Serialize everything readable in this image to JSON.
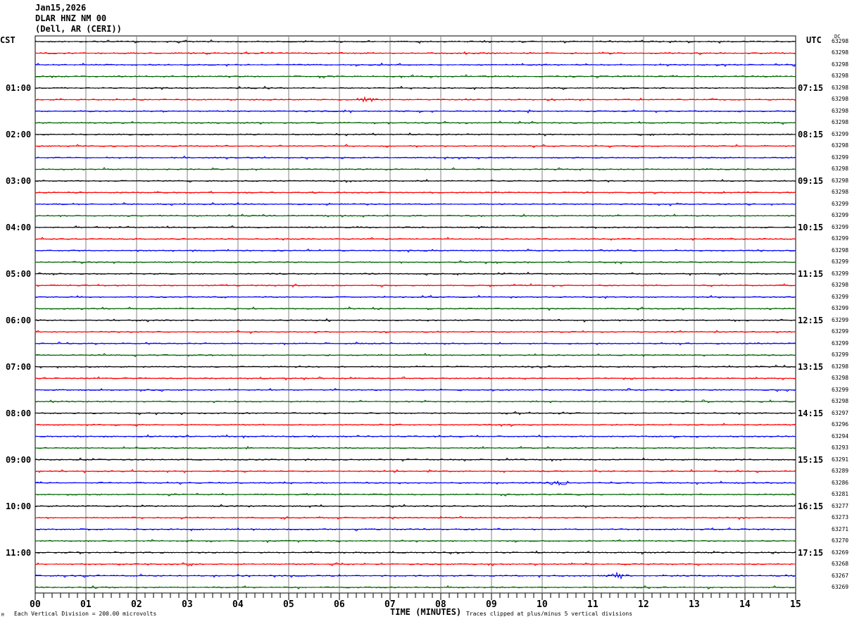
{
  "header": {
    "date": "Jan15,2026",
    "station": "DLAR HNZ NM 00",
    "location": "(Dell, AR (CERI))"
  },
  "left_tz": "CST",
  "right_tz": "UTC",
  "dc_label": "DC",
  "footer": {
    "scale": "Each Vertical Division =  200.00 microvolts",
    "xlabel": "TIME (MINUTES)",
    "clip_note": "Traces clipped at plus/minus 5 vertical divisions",
    "corner_mark": "M"
  },
  "chart_data": {
    "type": "line",
    "title": "Jan15,2026 DLAR HNZ NM 00 (Dell, AR (CERI))",
    "xlabel": "TIME (MINUTES)",
    "xlim": [
      0,
      15
    ],
    "x_ticks": [
      "00",
      "01",
      "02",
      "03",
      "04",
      "05",
      "06",
      "07",
      "08",
      "09",
      "10",
      "11",
      "12",
      "13",
      "14",
      "15"
    ],
    "trace_colors": [
      "#000000",
      "#ff0000",
      "#0000ff",
      "#006400"
    ],
    "trace_count": 48,
    "left_hour_labels": [
      "01:00",
      "02:00",
      "03:00",
      "04:00",
      "05:00",
      "06:00",
      "07:00",
      "08:00",
      "09:00",
      "10:00",
      "11:00"
    ],
    "right_hour_labels": [
      "07:15",
      "08:15",
      "09:15",
      "10:15",
      "11:15",
      "12:15",
      "13:15",
      "14:15",
      "15:15",
      "16:15",
      "17:15"
    ],
    "dc_values": [
      "63298",
      "63298",
      "63298",
      "63298",
      "63298",
      "63298",
      "63298",
      "63298",
      "63299",
      "63298",
      "63299",
      "63298",
      "63298",
      "63298",
      "63299",
      "63299",
      "63299",
      "63299",
      "63298",
      "63299",
      "63299",
      "63298",
      "63299",
      "63299",
      "63299",
      "63299",
      "63299",
      "63299",
      "63298",
      "63298",
      "63299",
      "63298",
      "63297",
      "63296",
      "63294",
      "63293",
      "63291",
      "63289",
      "63286",
      "63281",
      "63277",
      "63273",
      "63271",
      "63270",
      "63269",
      "63268",
      "63267",
      "63269"
    ],
    "events": [
      {
        "trace": 5,
        "minute": 6.55
      },
      {
        "trace": 38,
        "minute": 10.35
      },
      {
        "trace": 46,
        "minute": 11.5
      }
    ]
  }
}
